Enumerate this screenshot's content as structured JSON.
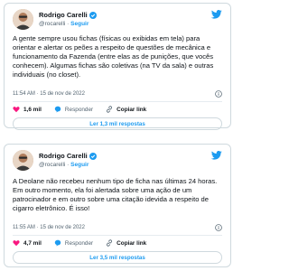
{
  "tweets": [
    {
      "author": {
        "name": "Rodrigo Carelli",
        "handle": "@rocarelli",
        "separator": "·",
        "follow_label": "Seguir"
      },
      "text": "A gente sempre usou fichas (físicas ou exibidas em tela) para orientar e alertar os peões a respeito de questões de mecânica e funcionamento da Fazenda (entre elas as de punições, que vocês conhecem). Algumas fichas são coletivas (na TV da sala) e outras individuais (no closet).",
      "timestamp": "11:54 AM · 15 de nov de 2022",
      "likes": "1,6 mil",
      "reply_label": "Responder",
      "copy_label": "Copiar link",
      "read_replies_label": "Ler 1,3 mil respostas"
    },
    {
      "author": {
        "name": "Rodrigo Carelli",
        "handle": "@rocarelli",
        "separator": "·",
        "follow_label": "Seguir"
      },
      "text": "A Deolane não recebeu nenhum tipo de ficha nas últimas 24 horas. Em outro momento, ela foi alertada sobre uma ação de um patrocinador e em outro sobre uma citação idevida a respeito de cigarro eletrônico. É isso!",
      "timestamp": "11:55 AM · 15 de nov de 2022",
      "likes": "4,7 mil",
      "reply_label": "Responder",
      "copy_label": "Copiar link",
      "read_replies_label": "Ler 3,5 mil respostas"
    }
  ],
  "colors": {
    "accent": "#1d9bf0",
    "like": "#f91880",
    "verified": "#1d9bf0",
    "text": "#0f1419",
    "muted": "#536471"
  },
  "icons": [
    "verified-badge-icon",
    "twitter-bird-icon",
    "info-icon",
    "heart-icon",
    "reply-bubble-icon",
    "link-icon"
  ]
}
